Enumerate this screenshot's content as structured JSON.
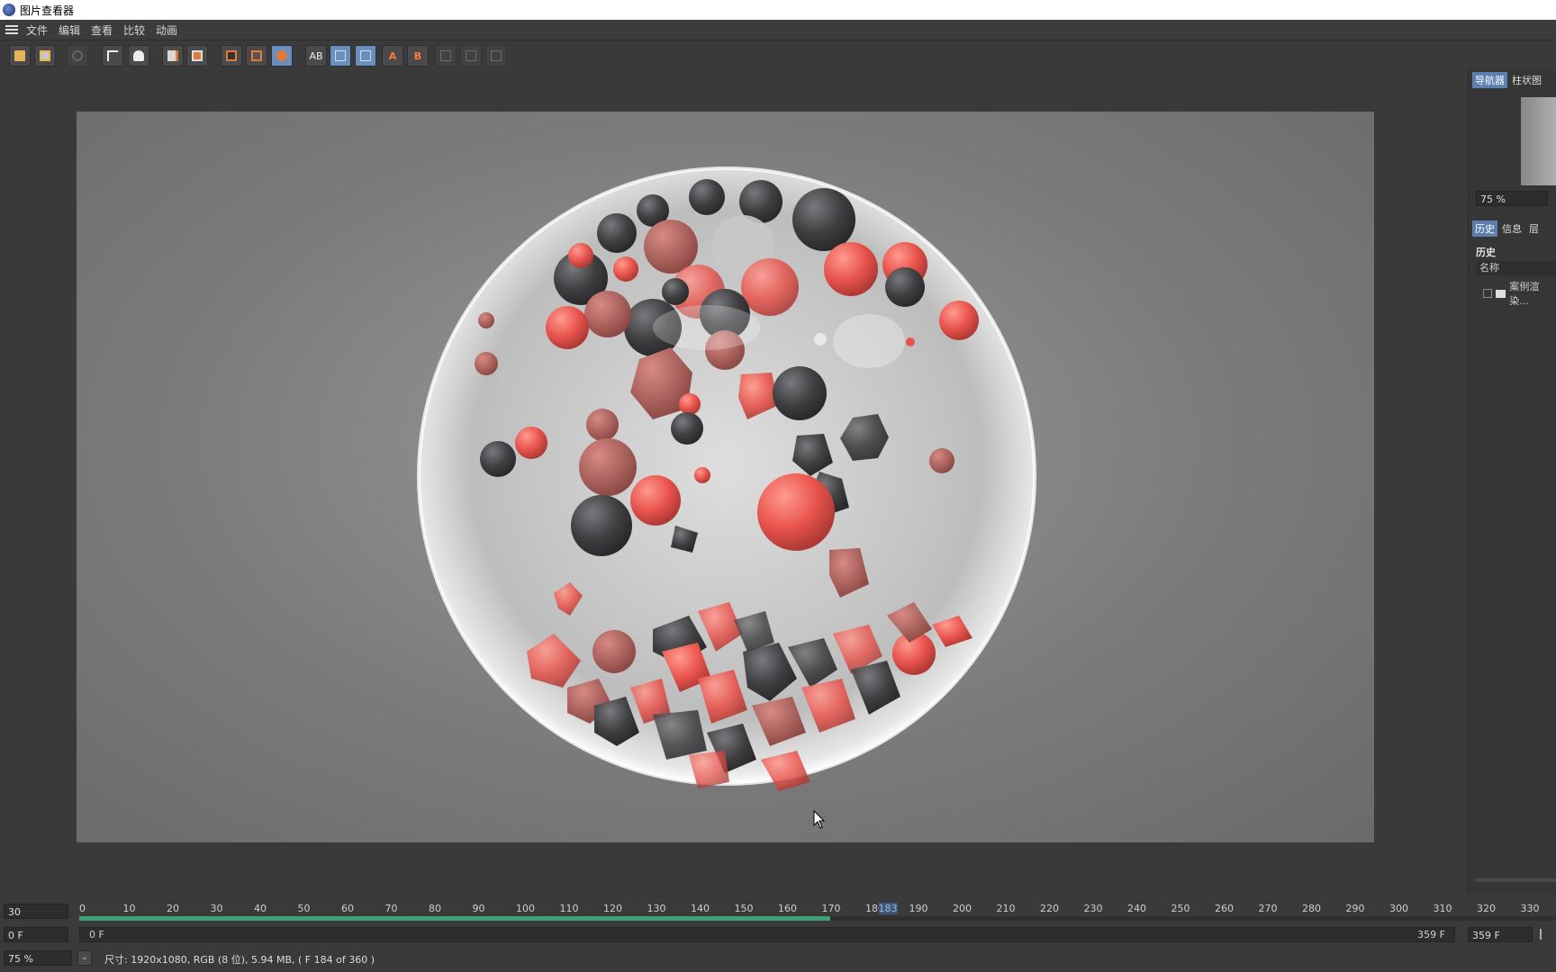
{
  "window": {
    "title": "图片查看器"
  },
  "menu": {
    "items": [
      "文件",
      "编辑",
      "查看",
      "比较",
      "动画"
    ]
  },
  "toolbar": {
    "buttons": [
      "open-icon",
      "save-icon",
      "stop-icon",
      "crop-icon",
      "user-icon",
      "doc-icon",
      "stack-icon",
      "frame-icon",
      "frame-alt-icon",
      "compare-icon",
      "ab-icon",
      "split-h-icon",
      "split-v-icon",
      "swap-a-icon",
      "swap-b-icon",
      "grid-a-icon",
      "grid-b-icon",
      "grid-c-icon"
    ],
    "ab_text": "AB",
    "a_text": "A",
    "b_text": "B"
  },
  "right_panel": {
    "tabs": [
      "导航器",
      "柱状图"
    ],
    "zoom": "75 %",
    "tabs2": [
      "历史",
      "信息",
      "层"
    ],
    "history_title": "历史",
    "column_name": "名称",
    "tree_item": "案例渲染..."
  },
  "timeline": {
    "fps": "30",
    "ticks": [
      "0",
      "10",
      "20",
      "30",
      "40",
      "50",
      "60",
      "70",
      "80",
      "90",
      "100",
      "110",
      "120",
      "130",
      "140",
      "150",
      "160",
      "170",
      "180",
      "183",
      "190",
      "200",
      "210",
      "220",
      "230",
      "240",
      "250",
      "260",
      "270",
      "280",
      "290",
      "300",
      "310",
      "320",
      "330"
    ],
    "current_frame_marker": "183",
    "start_field": "0 F",
    "range_start": "0 F",
    "range_end": "359 F",
    "end_field": "359 F",
    "progress": 0.5083
  },
  "status": {
    "zoom": "75 %",
    "info": "尺寸: 1920x1080, RGB (8 位), 5.94 MB,  ( F 184 of 360 )"
  },
  "colors": {
    "accent": "#5c7fb0",
    "timeline_green": "#3fa07a",
    "sphere_red": "#e8534c",
    "sphere_dark": "#3f3f42"
  }
}
